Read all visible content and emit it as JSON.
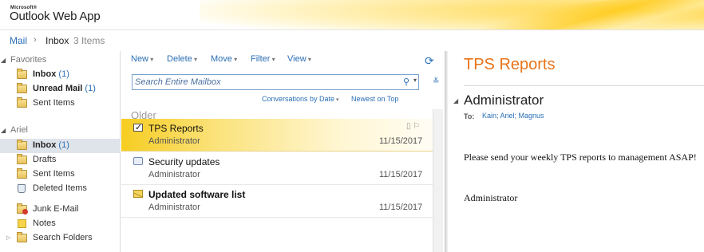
{
  "app": {
    "brand_small": "Microsoft®",
    "brand_name": "Outlook Web App"
  },
  "breadcrumb": {
    "root": "Mail",
    "separator": "›",
    "folder": "Inbox",
    "count": "3 Items"
  },
  "nav": {
    "favorites": {
      "label": "Favorites",
      "items": [
        {
          "label": "Inbox",
          "count": "1",
          "icon": "folder-icon"
        },
        {
          "label": "Unread Mail",
          "count": "1",
          "icon": "search-folder-icon"
        },
        {
          "label": "Sent Items",
          "icon": "folder-icon"
        }
      ]
    },
    "account": {
      "label": "Ariel",
      "items": [
        {
          "label": "Inbox",
          "count": "1",
          "icon": "folder-icon"
        },
        {
          "label": "Drafts",
          "icon": "drafts-icon"
        },
        {
          "label": "Sent Items",
          "icon": "folder-icon"
        },
        {
          "label": "Deleted Items",
          "icon": "trash-icon"
        },
        {
          "label": "Junk E-Mail",
          "icon": "junk-icon"
        },
        {
          "label": "Notes",
          "icon": "notes-icon"
        },
        {
          "label": "Search Folders",
          "icon": "folder-icon"
        }
      ]
    }
  },
  "toolbar": {
    "new": "New",
    "delete": "Delete",
    "move": "Move",
    "filter": "Filter",
    "view": "View"
  },
  "search": {
    "placeholder": "Search Entire Mailbox"
  },
  "sort": {
    "by": "Conversations by Date",
    "order": "Newest on Top"
  },
  "list": {
    "group_label": "Older",
    "messages": [
      {
        "subject": "TPS Reports",
        "from": "Administrator",
        "date": "11/15/2017"
      },
      {
        "subject": "Security updates",
        "from": "Administrator",
        "date": "11/15/2017"
      },
      {
        "subject": "Updated software list",
        "from": "Administrator",
        "date": "11/15/2017"
      }
    ]
  },
  "reading": {
    "subject": "TPS Reports",
    "from": "Administrator",
    "to_label": "To:",
    "to": "Kain; Ariel; Magnus",
    "body": "Please send your weekly TPS reports to management ASAP!",
    "signature": "Administrator"
  },
  "colors": {
    "accent": "#2a6fb5",
    "subject_orange": "#e8741a",
    "selected_row": "#f6cd21"
  }
}
